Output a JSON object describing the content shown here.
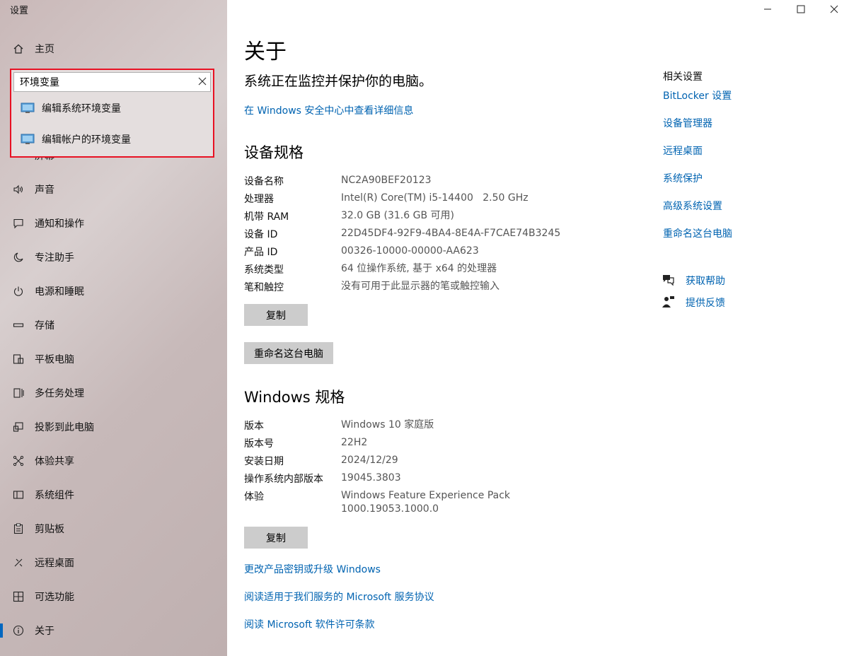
{
  "app": {
    "title": "设置"
  },
  "search": {
    "value": "环境变量",
    "placeholder": ""
  },
  "suggestions": [
    {
      "label": "编辑系统环境变量",
      "icon": "monitor-icon"
    },
    {
      "label": "编辑帐户的环境变量",
      "icon": "monitor-icon"
    }
  ],
  "sidebar": {
    "home_label": "主页",
    "hidden_item_partial": "屏幕",
    "items": [
      {
        "label": "声音",
        "icon": "speaker-icon"
      },
      {
        "label": "通知和操作",
        "icon": "message-icon"
      },
      {
        "label": "专注助手",
        "icon": "moon-icon"
      },
      {
        "label": "电源和睡眠",
        "icon": "power-icon"
      },
      {
        "label": "存储",
        "icon": "storage-icon"
      },
      {
        "label": "平板电脑",
        "icon": "tablet-icon"
      },
      {
        "label": "多任务处理",
        "icon": "multitask-icon"
      },
      {
        "label": "投影到此电脑",
        "icon": "project-icon"
      },
      {
        "label": "体验共享",
        "icon": "share-icon"
      },
      {
        "label": "系统组件",
        "icon": "components-icon"
      },
      {
        "label": "剪贴板",
        "icon": "clipboard-icon"
      },
      {
        "label": "远程桌面",
        "icon": "remote-icon"
      },
      {
        "label": "可选功能",
        "icon": "features-icon"
      },
      {
        "label": "关于",
        "icon": "info-icon",
        "active": true
      }
    ]
  },
  "main": {
    "title": "关于",
    "protect_text": "系统正在监控并保护你的电脑。",
    "security_link": "在 Windows 安全中心中查看详细信息",
    "device_section": "设备规格",
    "device_specs": [
      {
        "key": "设备名称",
        "value": "NC2A90BEF20123"
      },
      {
        "key": "处理器",
        "value": "Intel(R) Core(TM) i5-14400   2.50 GHz"
      },
      {
        "key": "机带 RAM",
        "value": "32.0 GB (31.6 GB 可用)"
      },
      {
        "key": "设备 ID",
        "value": "22D45DF4-92F9-4BA4-8E4A-F7CAE74B3245"
      },
      {
        "key": "产品 ID",
        "value": "00326-10000-00000-AA623"
      },
      {
        "key": "系统类型",
        "value": "64 位操作系统, 基于 x64 的处理器"
      },
      {
        "key": "笔和触控",
        "value": "没有可用于此显示器的笔或触控输入"
      }
    ],
    "copy_label": "复制",
    "rename_label": "重命名这台电脑",
    "windows_section": "Windows 规格",
    "windows_specs": [
      {
        "key": "版本",
        "value": "Windows 10 家庭版"
      },
      {
        "key": "版本号",
        "value": "22H2"
      },
      {
        "key": "安装日期",
        "value": "2024/12/29"
      },
      {
        "key": "操作系统内部版本",
        "value": "19045.3803"
      },
      {
        "key": "体验",
        "value": "Windows Feature Experience Pack",
        "value2": "1000.19053.1000.0"
      }
    ],
    "copy2_label": "复制",
    "links": [
      "更改产品密钥或升级 Windows",
      "阅读适用于我们服务的 Microsoft 服务协议",
      "阅读 Microsoft 软件许可条款"
    ]
  },
  "related": {
    "title": "相关设置",
    "links": [
      "BitLocker 设置",
      "设备管理器",
      "远程桌面",
      "系统保护",
      "高级系统设置",
      "重命名这台电脑"
    ],
    "help_label": "获取帮助",
    "feedback_label": "提供反馈"
  },
  "colors": {
    "accent": "#0063b1",
    "highlight_border": "#e81123"
  }
}
